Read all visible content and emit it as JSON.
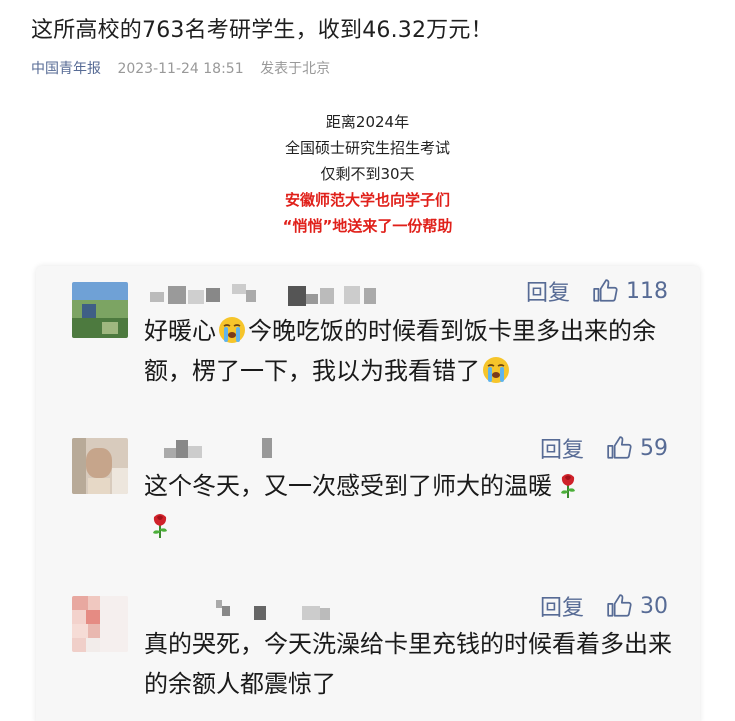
{
  "article": {
    "title": "这所高校的763名考研学生，收到46.32万元！",
    "source": "中国青年报",
    "date": "2023-11-24 18:51",
    "location": "发表于北京"
  },
  "intro": {
    "line1": "距离2024年",
    "line2": "全国硕士研究生招生考试",
    "line3": "仅剩不到30天",
    "line4": "安徽师范大学也向学子们",
    "line5": "“悄悄”地送来了一份帮助"
  },
  "colors": {
    "link": "#576b95",
    "highlight": "#e0201a",
    "card_bg": "#f7f7f7"
  },
  "comments": [
    {
      "reply_label": "回复",
      "likes": "118",
      "text_a": "好暖心",
      "emoji_a": "loudly-crying-face-emoji",
      "text_b": "今晚吃饭的时候看到饭卡里多出来的余额，楞了一下，我以为我看错了",
      "emoji_b": "loudly-crying-face-emoji"
    },
    {
      "reply_label": "回复",
      "likes": "59",
      "text_a": "这个冬天，又一次感受到了师大的温暖",
      "emoji_a": "rose-emoji",
      "emoji_b": "rose-emoji"
    },
    {
      "reply_label": "回复",
      "likes": "30",
      "text_a": "真的哭死，今天洗澡给卡里充钱的时候看着多出来的余额人都震惊了"
    }
  ]
}
